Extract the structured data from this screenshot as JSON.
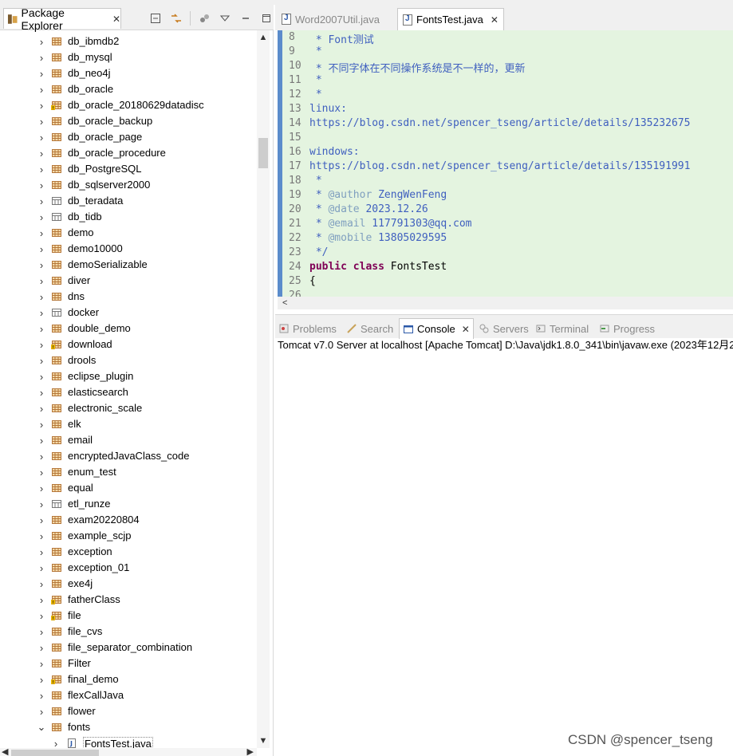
{
  "package_explorer": {
    "tab_label": "Package Explorer",
    "items": [
      {
        "label": "db_ibmdb2",
        "icon": "project"
      },
      {
        "label": "db_mysql",
        "icon": "project"
      },
      {
        "label": "db_neo4j",
        "icon": "project"
      },
      {
        "label": "db_oracle",
        "icon": "project"
      },
      {
        "label": "db_oracle_20180629datadisc",
        "icon": "project-warning"
      },
      {
        "label": "db_oracle_backup",
        "icon": "project"
      },
      {
        "label": "db_oracle_page",
        "icon": "project"
      },
      {
        "label": "db_oracle_procedure",
        "icon": "project"
      },
      {
        "label": "db_PostgreSQL",
        "icon": "project"
      },
      {
        "label": "db_sqlserver2000",
        "icon": "project"
      },
      {
        "label": "db_teradata",
        "icon": "project-plain"
      },
      {
        "label": "db_tidb",
        "icon": "project-plain"
      },
      {
        "label": "demo",
        "icon": "project"
      },
      {
        "label": "demo10000",
        "icon": "project"
      },
      {
        "label": "demoSerializable",
        "icon": "project"
      },
      {
        "label": "diver",
        "icon": "project"
      },
      {
        "label": "dns",
        "icon": "project"
      },
      {
        "label": "docker",
        "icon": "project-plain"
      },
      {
        "label": "double_demo",
        "icon": "project"
      },
      {
        "label": "download",
        "icon": "project-warning"
      },
      {
        "label": "drools",
        "icon": "project"
      },
      {
        "label": "eclipse_plugin",
        "icon": "project"
      },
      {
        "label": "elasticsearch",
        "icon": "project"
      },
      {
        "label": "electronic_scale",
        "icon": "project"
      },
      {
        "label": "elk",
        "icon": "project"
      },
      {
        "label": "email",
        "icon": "project"
      },
      {
        "label": "encryptedJavaClass_code",
        "icon": "project"
      },
      {
        "label": "enum_test",
        "icon": "project"
      },
      {
        "label": "equal",
        "icon": "project"
      },
      {
        "label": "etl_runze",
        "icon": "project-plain"
      },
      {
        "label": "exam20220804",
        "icon": "project"
      },
      {
        "label": "example_scjp",
        "icon": "project"
      },
      {
        "label": "exception",
        "icon": "project"
      },
      {
        "label": "exception_01",
        "icon": "project"
      },
      {
        "label": "exe4j",
        "icon": "project"
      },
      {
        "label": "fatherClass",
        "icon": "project-warning"
      },
      {
        "label": "file",
        "icon": "project-warning"
      },
      {
        "label": "file_cvs",
        "icon": "project"
      },
      {
        "label": "file_separator_combination",
        "icon": "project"
      },
      {
        "label": "Filter",
        "icon": "project"
      },
      {
        "label": "final_demo",
        "icon": "project-warning"
      },
      {
        "label": "flexCallJava",
        "icon": "project"
      },
      {
        "label": "flower",
        "icon": "project"
      },
      {
        "label": "fonts",
        "icon": "project",
        "expanded": true
      }
    ],
    "child": {
      "label": "FontsTest.java",
      "icon": "java-file"
    }
  },
  "editor": {
    "tabs": [
      {
        "label": "Word2007Util.java",
        "active": false
      },
      {
        "label": "FontsTest.java",
        "active": true
      }
    ],
    "lines": [
      {
        "n": "8",
        "parts": [
          {
            "t": " * Font测试",
            "c": "com"
          }
        ]
      },
      {
        "n": "9",
        "parts": [
          {
            "t": " *",
            "c": "com"
          }
        ]
      },
      {
        "n": "10",
        "parts": [
          {
            "t": " * 不同字体在不同操作系统是不一样的，更新",
            "c": "com"
          }
        ]
      },
      {
        "n": "11",
        "parts": [
          {
            "t": " *",
            "c": "com"
          }
        ]
      },
      {
        "n": "12",
        "parts": [
          {
            "t": " *",
            "c": "com"
          }
        ]
      },
      {
        "n": "13",
        "parts": [
          {
            "t": "linux:",
            "c": "com"
          }
        ]
      },
      {
        "n": "14",
        "parts": [
          {
            "t": "https://blog.csdn.net/spencer_tseng/article/details/135232675",
            "c": "com"
          }
        ]
      },
      {
        "n": "15",
        "parts": [
          {
            "t": "",
            "c": "com"
          }
        ]
      },
      {
        "n": "16",
        "parts": [
          {
            "t": "windows:",
            "c": "com"
          }
        ]
      },
      {
        "n": "17",
        "parts": [
          {
            "t": "https://blog.csdn.net/spencer_tseng/article/details/135191991",
            "c": "com"
          }
        ]
      },
      {
        "n": "18",
        "parts": [
          {
            "t": " *",
            "c": "com"
          }
        ]
      },
      {
        "n": "19",
        "parts": [
          {
            "t": " * ",
            "c": "com"
          },
          {
            "t": "@author",
            "c": "tag"
          },
          {
            "t": " ZengWenFeng",
            "c": "com"
          }
        ]
      },
      {
        "n": "20",
        "parts": [
          {
            "t": " * ",
            "c": "com"
          },
          {
            "t": "@date",
            "c": "tag"
          },
          {
            "t": " 2023.12.26",
            "c": "com"
          }
        ]
      },
      {
        "n": "21",
        "parts": [
          {
            "t": " * ",
            "c": "com"
          },
          {
            "t": "@email",
            "c": "tag"
          },
          {
            "t": " 117791303@qq.com",
            "c": "com"
          }
        ]
      },
      {
        "n": "22",
        "parts": [
          {
            "t": " * ",
            "c": "com"
          },
          {
            "t": "@mobile",
            "c": "tag"
          },
          {
            "t": " 13805029595",
            "c": "com"
          }
        ]
      },
      {
        "n": "23",
        "parts": [
          {
            "t": " */",
            "c": "com"
          }
        ]
      },
      {
        "n": "24",
        "parts": [
          {
            "t": "public",
            "c": "kw"
          },
          {
            "t": " ",
            "c": "plain"
          },
          {
            "t": "class",
            "c": "kw"
          },
          {
            "t": " FontsTest",
            "c": "plain"
          }
        ]
      },
      {
        "n": "25",
        "parts": [
          {
            "t": "{",
            "c": "plain"
          }
        ]
      },
      {
        "n": "26",
        "parts": [
          {
            "t": "",
            "c": "plain"
          }
        ]
      }
    ]
  },
  "console": {
    "tabs": [
      {
        "label": "Problems",
        "active": false
      },
      {
        "label": "Search",
        "active": false
      },
      {
        "label": "Console",
        "active": true
      },
      {
        "label": "Servers",
        "active": false
      },
      {
        "label": "Terminal",
        "active": false
      },
      {
        "label": "Progress",
        "active": false
      }
    ],
    "output_line": "Tomcat v7.0 Server at localhost [Apache Tomcat] D:\\Java\\jdk1.8.0_341\\bin\\javaw.exe (2023年12月2"
  },
  "watermark": "CSDN @spencer_tseng",
  "colors": {
    "code_bg": "#e4f4e0",
    "comment": "#3f5fbf",
    "javadoc_tag": "#7f9fbf",
    "keyword": "#7f0055",
    "project_icon": "#b5773a"
  }
}
